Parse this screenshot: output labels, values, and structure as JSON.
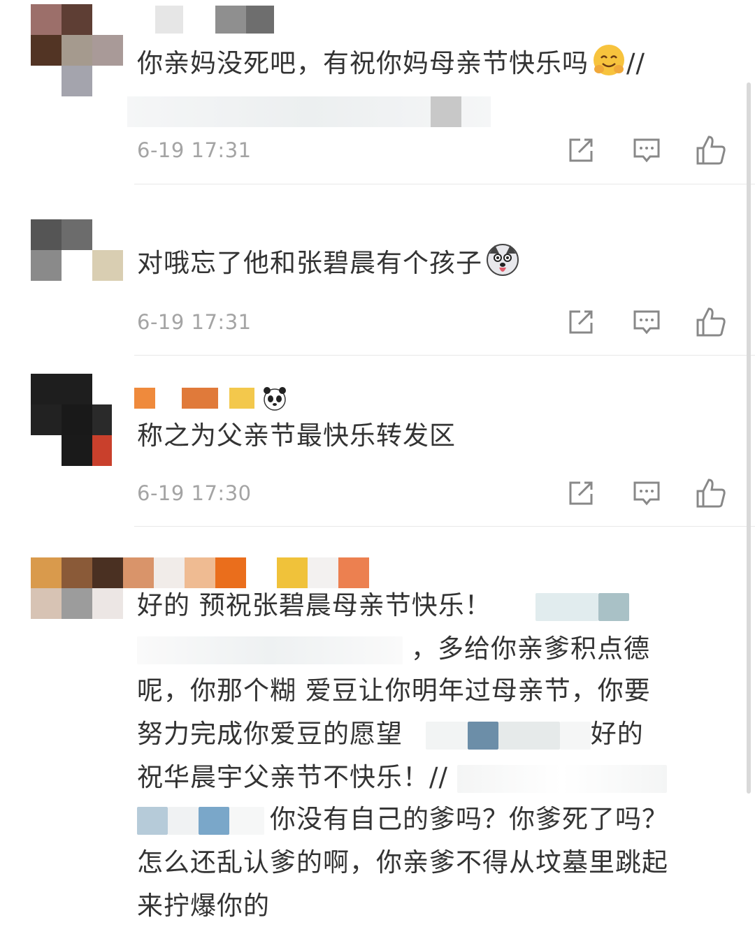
{
  "comments": [
    {
      "text": "你亲妈没死吧，有祝你妈母亲节快乐吗",
      "text_suffix": "//",
      "emoji": "hug-emoji",
      "time": "6-19 17:31"
    },
    {
      "text": "对哦忘了他和张碧晨有个孩子",
      "emoji": "husky-dog-emoji",
      "time": "6-19 17:31"
    },
    {
      "name_emoji": "panda-emoji",
      "text": "称之为父亲节最快乐转发区",
      "time": "6-19 17:30"
    },
    {
      "lines": [
        "好的 预祝张碧晨母亲节快乐！",
        "，多给你亲爹积点德",
        "呢，你那个糊  爱豆让你明年过母亲节，你要",
        "努力完成你爱豆的愿望",
        "好的",
        "祝华晨宇父亲节不快乐！//",
        "你没有自己的爹吗？你爹死了吗？",
        "怎么还乱认爹的啊，你亲爹不得从坟墓里跳起",
        "来拧爆你的"
      ]
    }
  ],
  "actions": {
    "repost_icon": "repost-icon",
    "reply_icon": "comment-icon",
    "like_icon": "thumbs-up-icon"
  },
  "colors": {
    "text": "#333333",
    "timestamp": "#a4a4a4",
    "icon": "#888888",
    "divider": "#e8e8e8"
  }
}
